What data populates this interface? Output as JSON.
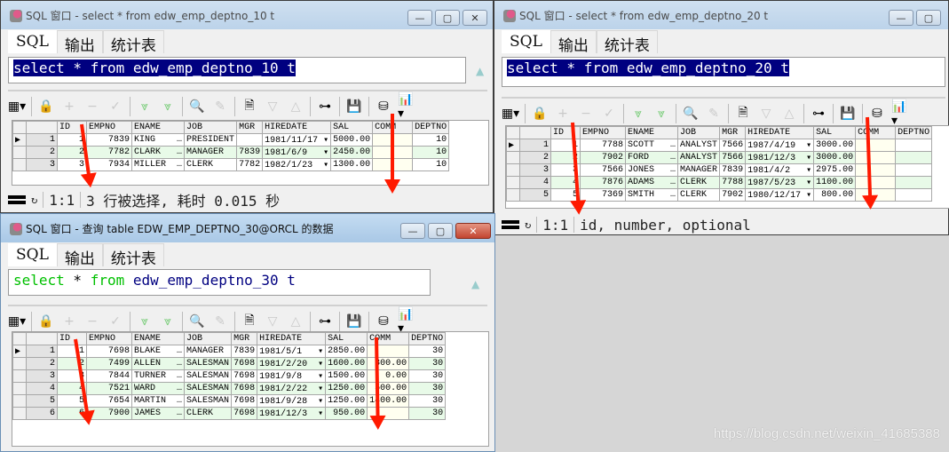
{
  "windows": [
    {
      "title": "SQL 窗口 - select * from edw_emp_deptno_10 t",
      "tabs": [
        "SQL",
        "输出",
        "统计表"
      ],
      "query": "select * from edw_emp_deptno_10 t",
      "query_selected": true,
      "columns": [
        "ID",
        "EMPNO",
        "ENAME",
        "JOB",
        "MGR",
        "HIREDATE",
        "SAL",
        "COMM",
        "DEPTNO"
      ],
      "rows": [
        {
          "n": "1",
          "ID": "1",
          "EMPNO": "7839",
          "ENAME": "KING",
          "JOB": "PRESIDENT",
          "MGR": "",
          "HIREDATE": "1981/11/17",
          "SAL": "5000.00",
          "COMM": "",
          "DEPTNO": "10"
        },
        {
          "n": "2",
          "ID": "2",
          "EMPNO": "7782",
          "ENAME": "CLARK",
          "JOB": "MANAGER",
          "MGR": "7839",
          "HIREDATE": "1981/6/9",
          "SAL": "2450.00",
          "COMM": "",
          "DEPTNO": "10"
        },
        {
          "n": "3",
          "ID": "3",
          "EMPNO": "7934",
          "ENAME": "MILLER",
          "JOB": "CLERK",
          "MGR": "7782",
          "HIREDATE": "1982/1/23",
          "SAL": "1300.00",
          "COMM": "",
          "DEPTNO": "10"
        }
      ],
      "status": {
        "position": "1:1",
        "message": "3 行被选择, 耗时 0.015 秒"
      }
    },
    {
      "title": "SQL 窗口 - select * from edw_emp_deptno_20 t",
      "tabs": [
        "SQL",
        "输出",
        "统计表"
      ],
      "query": "select * from edw_emp_deptno_20 t",
      "query_selected": true,
      "columns": [
        "ID",
        "EMPNO",
        "ENAME",
        "JOB",
        "MGR",
        "HIREDATE",
        "SAL",
        "COMM",
        "DEPTNO"
      ],
      "rows": [
        {
          "n": "1",
          "ID": "1",
          "EMPNO": "7788",
          "ENAME": "SCOTT",
          "JOB": "ANALYST",
          "MGR": "7566",
          "HIREDATE": "1987/4/19",
          "SAL": "3000.00",
          "COMM": "",
          "DEPTNO": ""
        },
        {
          "n": "2",
          "ID": "2",
          "EMPNO": "7902",
          "ENAME": "FORD",
          "JOB": "ANALYST",
          "MGR": "7566",
          "HIREDATE": "1981/12/3",
          "SAL": "3000.00",
          "COMM": "",
          "DEPTNO": ""
        },
        {
          "n": "3",
          "ID": "3",
          "EMPNO": "7566",
          "ENAME": "JONES",
          "JOB": "MANAGER",
          "MGR": "7839",
          "HIREDATE": "1981/4/2",
          "SAL": "2975.00",
          "COMM": "",
          "DEPTNO": ""
        },
        {
          "n": "4",
          "ID": "4",
          "EMPNO": "7876",
          "ENAME": "ADAMS",
          "JOB": "CLERK",
          "MGR": "7788",
          "HIREDATE": "1987/5/23",
          "SAL": "1100.00",
          "COMM": "",
          "DEPTNO": ""
        },
        {
          "n": "5",
          "ID": "5",
          "EMPNO": "7369",
          "ENAME": "SMITH",
          "JOB": "CLERK",
          "MGR": "7902",
          "HIREDATE": "1980/12/17",
          "SAL": "800.00",
          "COMM": "",
          "DEPTNO": ""
        }
      ],
      "status": {
        "position": "1:1",
        "message": "id, number, optional"
      }
    },
    {
      "title": "SQL 窗口 - 查询 table EDW_EMP_DEPTNO_30@ORCL 的数据",
      "tabs": [
        "SQL",
        "输出",
        "统计表"
      ],
      "query": "select * from edw_emp_deptno_30 t",
      "query_selected": false,
      "columns": [
        "ID",
        "EMPNO",
        "ENAME",
        "JOB",
        "MGR",
        "HIREDATE",
        "SAL",
        "COMM",
        "DEPTNO"
      ],
      "rows": [
        {
          "n": "1",
          "ID": "1",
          "EMPNO": "7698",
          "ENAME": "BLAKE",
          "JOB": "MANAGER",
          "MGR": "7839",
          "HIREDATE": "1981/5/1",
          "SAL": "2850.00",
          "COMM": "",
          "DEPTNO": "30"
        },
        {
          "n": "2",
          "ID": "2",
          "EMPNO": "7499",
          "ENAME": "ALLEN",
          "JOB": "SALESMAN",
          "MGR": "7698",
          "HIREDATE": "1981/2/20",
          "SAL": "1600.00",
          "COMM": "300.00",
          "DEPTNO": "30"
        },
        {
          "n": "3",
          "ID": "3",
          "EMPNO": "7844",
          "ENAME": "TURNER",
          "JOB": "SALESMAN",
          "MGR": "7698",
          "HIREDATE": "1981/9/8",
          "SAL": "1500.00",
          "COMM": "0.00",
          "DEPTNO": "30"
        },
        {
          "n": "4",
          "ID": "4",
          "EMPNO": "7521",
          "ENAME": "WARD",
          "JOB": "SALESMAN",
          "MGR": "7698",
          "HIREDATE": "1981/2/22",
          "SAL": "1250.00",
          "COMM": "500.00",
          "DEPTNO": "30"
        },
        {
          "n": "5",
          "ID": "5",
          "EMPNO": "7654",
          "ENAME": "MARTIN",
          "JOB": "SALESMAN",
          "MGR": "7698",
          "HIREDATE": "1981/9/28",
          "SAL": "1250.00",
          "COMM": "1400.00",
          "DEPTNO": "30"
        },
        {
          "n": "6",
          "ID": "6",
          "EMPNO": "7900",
          "ENAME": "JAMES",
          "JOB": "CLERK",
          "MGR": "7698",
          "HIREDATE": "1981/12/3",
          "SAL": "950.00",
          "COMM": "",
          "DEPTNO": "30"
        }
      ],
      "status": null
    }
  ],
  "toolbar_icons": [
    "grid-options-icon",
    "lock-icon",
    "add-record-icon",
    "delete-record-icon",
    "post-changes-icon",
    "fetch-next-icon",
    "fetch-last-icon",
    "find-icon",
    "clear-icon",
    "query-by-example-icon",
    "previous-icon",
    "next-icon",
    "explain-plan-icon",
    "save-icon",
    "export-icon",
    "chart-icon"
  ],
  "toolbar_glyphs": [
    "▦▾",
    "🔒",
    "+",
    "−",
    "✓",
    "⩔",
    "⩔",
    "🔍",
    "✎",
    "🗎",
    "▽",
    "△",
    "⊶",
    "💾",
    "⛁",
    "📊▾"
  ],
  "watermark": "https://blog.csdn.net/weixin_41685388",
  "icons": {
    "minimize": "—",
    "maximize": "▢",
    "close": "✕",
    "row_pointer": "▶",
    "dropdown": "▾",
    "ellipsis": "…",
    "scroll_up": "▲"
  }
}
